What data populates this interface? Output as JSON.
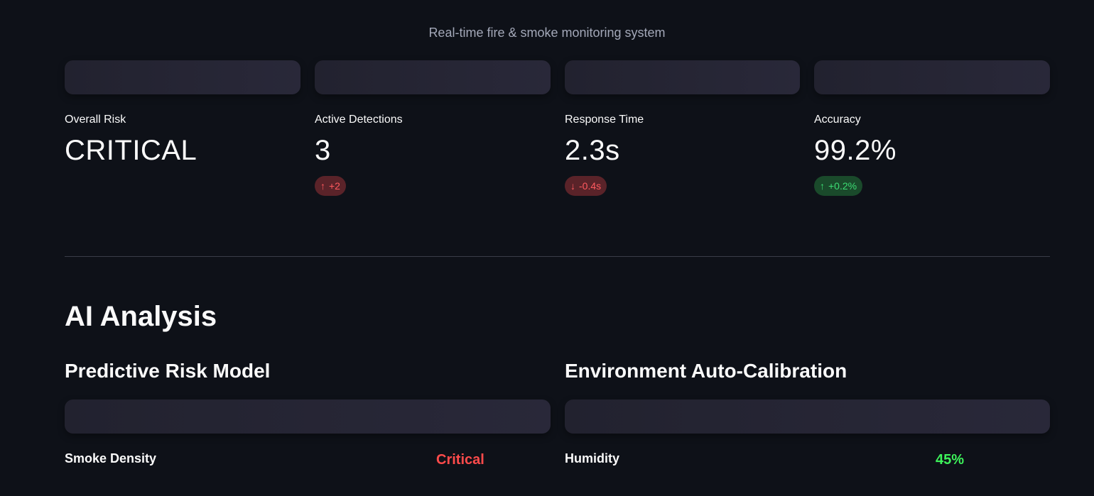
{
  "header": {
    "subtitle": "Real-time fire & smoke monitoring system"
  },
  "metrics": [
    {
      "label": "Overall Risk",
      "value": "CRITICAL",
      "delta": null
    },
    {
      "label": "Active Detections",
      "value": "3",
      "delta": {
        "arrow": "↑",
        "text": "+2",
        "tone": "red"
      }
    },
    {
      "label": "Response Time",
      "value": "2.3s",
      "delta": {
        "arrow": "↓",
        "text": "-0.4s",
        "tone": "red"
      }
    },
    {
      "label": "Accuracy",
      "value": "99.2%",
      "delta": {
        "arrow": "↑",
        "text": "+0.2%",
        "tone": "green"
      }
    }
  ],
  "analysis": {
    "title": "AI Analysis",
    "predictive": {
      "title": "Predictive Risk Model",
      "row_label": "Smoke Density",
      "row_value": "Critical",
      "row_value_color": "#ff4b4b"
    },
    "calibration": {
      "title": "Environment Auto-Calibration",
      "row_label": "Humidity",
      "row_value": "45%",
      "row_value_color": "#3df25a"
    }
  },
  "colors": {
    "background": "#0e1118",
    "delta_red_bg": "#5a2329",
    "delta_red_text": "#ff5a5f",
    "delta_green_bg": "#1a4a2b",
    "delta_green_text": "#3ddc74"
  }
}
